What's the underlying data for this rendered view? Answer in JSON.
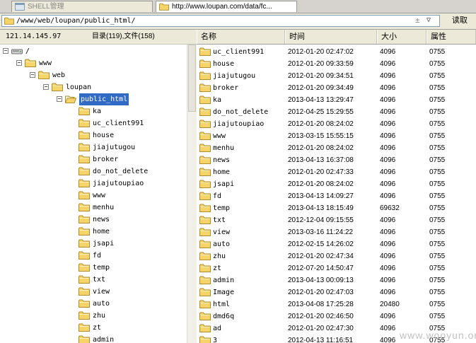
{
  "tabs": [
    {
      "label": "SHELL管理"
    },
    {
      "label": "http://www.loupan.com/data/fc..."
    }
  ],
  "address": {
    "path": "/www/web/loupan/public_html/",
    "plus_minus": "±",
    "read_button": "读取"
  },
  "status": {
    "ip": "121.14.145.97",
    "counts": "目录(119),文件(158)"
  },
  "tree": [
    {
      "label": "/",
      "depth": 0,
      "type": "drive",
      "exp": "−"
    },
    {
      "label": "www",
      "depth": 1,
      "type": "folder",
      "exp": "−"
    },
    {
      "label": "web",
      "depth": 2,
      "type": "folder",
      "exp": "−"
    },
    {
      "label": "loupan",
      "depth": 3,
      "type": "folder",
      "exp": "−"
    },
    {
      "label": "public_html",
      "depth": 4,
      "type": "openfolder",
      "exp": "−",
      "selected": true
    },
    {
      "label": "ka",
      "depth": 5,
      "type": "folder"
    },
    {
      "label": "uc_client991",
      "depth": 5,
      "type": "folder"
    },
    {
      "label": "house",
      "depth": 5,
      "type": "folder"
    },
    {
      "label": "jiajutugou",
      "depth": 5,
      "type": "folder"
    },
    {
      "label": "broker",
      "depth": 5,
      "type": "folder"
    },
    {
      "label": "do_not_delete",
      "depth": 5,
      "type": "folder"
    },
    {
      "label": "jiajutoupiao",
      "depth": 5,
      "type": "folder"
    },
    {
      "label": "www",
      "depth": 5,
      "type": "folder"
    },
    {
      "label": "menhu",
      "depth": 5,
      "type": "folder"
    },
    {
      "label": "news",
      "depth": 5,
      "type": "folder"
    },
    {
      "label": "home",
      "depth": 5,
      "type": "folder"
    },
    {
      "label": "jsapi",
      "depth": 5,
      "type": "folder"
    },
    {
      "label": "fd",
      "depth": 5,
      "type": "folder"
    },
    {
      "label": "temp",
      "depth": 5,
      "type": "folder"
    },
    {
      "label": "txt",
      "depth": 5,
      "type": "folder"
    },
    {
      "label": "view",
      "depth": 5,
      "type": "folder"
    },
    {
      "label": "auto",
      "depth": 5,
      "type": "folder"
    },
    {
      "label": "zhu",
      "depth": 5,
      "type": "folder"
    },
    {
      "label": "zt",
      "depth": 5,
      "type": "folder"
    },
    {
      "label": "admin",
      "depth": 5,
      "type": "folder"
    }
  ],
  "columns": {
    "name": "名称",
    "time": "时间",
    "size": "大小",
    "perm": "属性"
  },
  "files": [
    {
      "name": "uc_client991",
      "time": "2012-01-20 02:47:02",
      "size": "4096",
      "perm": "0755"
    },
    {
      "name": "house",
      "time": "2012-01-20 09:33:59",
      "size": "4096",
      "perm": "0755"
    },
    {
      "name": "jiajutugou",
      "time": "2012-01-20 09:34:51",
      "size": "4096",
      "perm": "0755"
    },
    {
      "name": "broker",
      "time": "2012-01-20 09:34:49",
      "size": "4096",
      "perm": "0755"
    },
    {
      "name": "ka",
      "time": "2013-04-13 13:29:47",
      "size": "4096",
      "perm": "0755"
    },
    {
      "name": "do_not_delete",
      "time": "2012-04-25 15:29:55",
      "size": "4096",
      "perm": "0755"
    },
    {
      "name": "jiajutoupiao",
      "time": "2012-01-20 08:24:02",
      "size": "4096",
      "perm": "0755"
    },
    {
      "name": "www",
      "time": "2013-03-15 15:55:15",
      "size": "4096",
      "perm": "0755"
    },
    {
      "name": "menhu",
      "time": "2012-01-20 08:24:02",
      "size": "4096",
      "perm": "0755"
    },
    {
      "name": "news",
      "time": "2013-04-13 16:37:08",
      "size": "4096",
      "perm": "0755"
    },
    {
      "name": "home",
      "time": "2012-01-20 02:47:33",
      "size": "4096",
      "perm": "0755"
    },
    {
      "name": "jsapi",
      "time": "2012-01-20 08:24:02",
      "size": "4096",
      "perm": "0755"
    },
    {
      "name": "fd",
      "time": "2013-04-13 14:09:27",
      "size": "4096",
      "perm": "0755"
    },
    {
      "name": "temp",
      "time": "2013-04-13 18:15:49",
      "size": "69632",
      "perm": "0755"
    },
    {
      "name": "txt",
      "time": "2012-12-04 09:15:55",
      "size": "4096",
      "perm": "0755"
    },
    {
      "name": "view",
      "time": "2013-03-16 11:24:22",
      "size": "4096",
      "perm": "0755"
    },
    {
      "name": "auto",
      "time": "2012-02-15 14:26:02",
      "size": "4096",
      "perm": "0755"
    },
    {
      "name": "zhu",
      "time": "2012-01-20 02:47:34",
      "size": "4096",
      "perm": "0755"
    },
    {
      "name": "zt",
      "time": "2012-07-20 14:50:47",
      "size": "4096",
      "perm": "0755"
    },
    {
      "name": "admin",
      "time": "2013-04-13 00:09:13",
      "size": "4096",
      "perm": "0755"
    },
    {
      "name": "Image",
      "time": "2012-01-20 02:47:03",
      "size": "4096",
      "perm": "0755"
    },
    {
      "name": "html",
      "time": "2013-04-08 17:25:28",
      "size": "20480",
      "perm": "0755"
    },
    {
      "name": "dmd6q",
      "time": "2012-01-20 02:46:50",
      "size": "4096",
      "perm": "0755"
    },
    {
      "name": "ad",
      "time": "2012-01-20 02:47:30",
      "size": "4096",
      "perm": "0755"
    },
    {
      "name": "3",
      "time": "2012-04-13 11:16:51",
      "size": "4096",
      "perm": "0755"
    }
  ],
  "watermark": "www.wooyun.org",
  "colors": {
    "folder": "#f6d46a",
    "selection": "#316ac5",
    "chrome": "#ece9d8"
  }
}
